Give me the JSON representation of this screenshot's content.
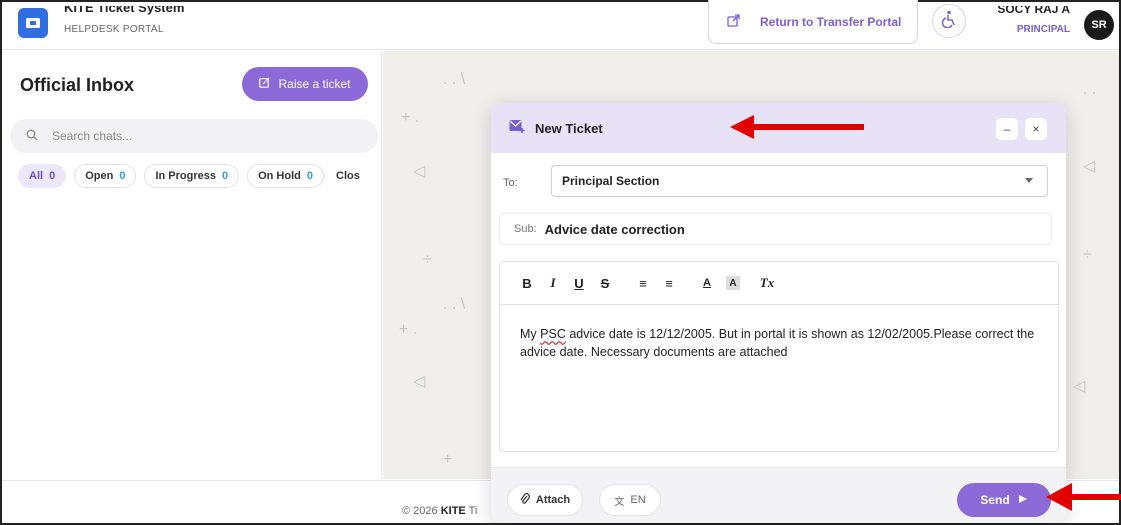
{
  "header": {
    "app_title": "KITE Ticket System",
    "app_subtitle": "HELPDESK PORTAL",
    "return_label": "Return to Transfer Portal",
    "user_name": "SOCY RAJ A R",
    "user_role": "PRINCIPAL",
    "avatar_initials": "SR"
  },
  "sidebar": {
    "title": "Official Inbox",
    "raise_label": "Raise a ticket",
    "search_placeholder": "Search chats...",
    "filters": [
      {
        "label": "All",
        "count": "0"
      },
      {
        "label": "Open",
        "count": "0"
      },
      {
        "label": "In Progress",
        "count": "0"
      },
      {
        "label": "On Hold",
        "count": "0"
      },
      {
        "label": "Clos",
        "count": ""
      }
    ]
  },
  "modal": {
    "title": "New Ticket",
    "minimize": "–",
    "close": "×",
    "to_label": "To:",
    "to_value": "Principal Section",
    "sub_label": "Sub:",
    "sub_value": "Advice date correction",
    "toolbar": {
      "bold": "B",
      "italic": "I",
      "underline": "U",
      "strike": "S",
      "ordered_list": "≡",
      "bullet_list": "≡",
      "text_color": "A",
      "bg_color": "A",
      "clear_format": "Tx"
    },
    "body_pre": "My ",
    "body_spell": "PSC",
    "body_post": " advice date is 12/12/2005. But in portal it is shown as 12/02/2005.Please correct the advice date. Necessary documents are attached",
    "attach_label": "Attach",
    "lang_label": "EN",
    "send_label": "Send"
  },
  "footer": {
    "copy_prefix": "© 2026 ",
    "copy_brand": "KITE",
    "copy_suffix": " Ti"
  },
  "colors": {
    "accent": "#8b6ad8",
    "header_bg": "#e8e2f7",
    "arrow": "#e00000"
  }
}
